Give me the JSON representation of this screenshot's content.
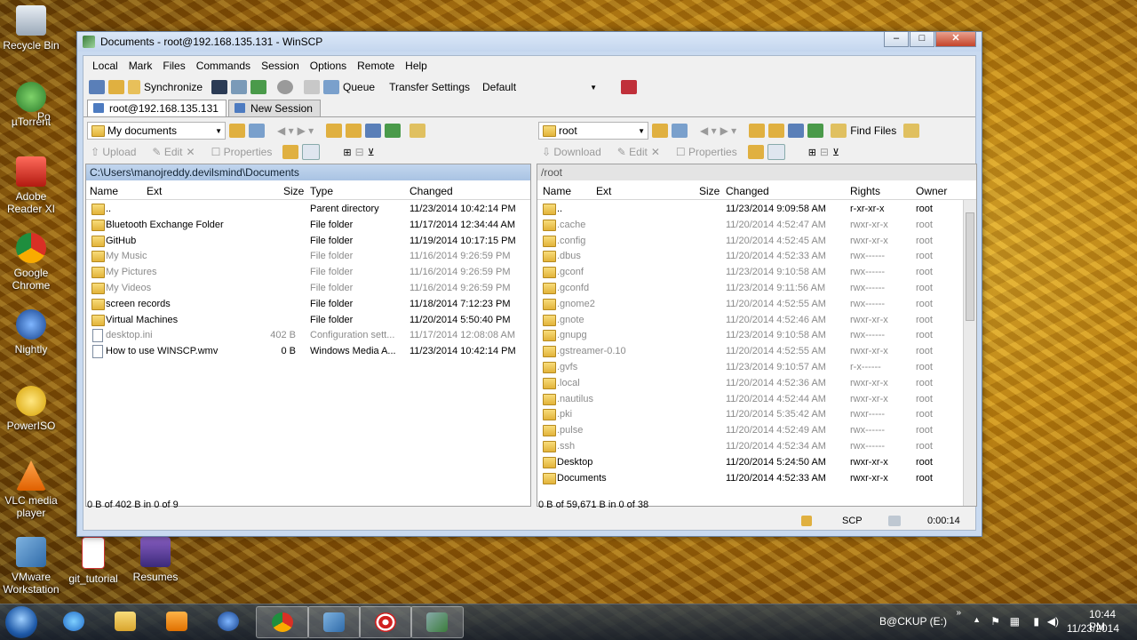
{
  "desktop": {
    "icons": [
      {
        "label": "Recycle Bin"
      },
      {
        "label": "µTorrent"
      },
      {
        "label": "Po"
      },
      {
        "label": "Adobe Reader XI"
      },
      {
        "label": "Google Chrome"
      },
      {
        "label": "Nightly"
      },
      {
        "label": "PowerISO"
      },
      {
        "label": "VLC media player"
      },
      {
        "label": "VMware Workstation"
      },
      {
        "label": "git_tutorial"
      },
      {
        "label": "Resumes"
      }
    ]
  },
  "window": {
    "title": "Documents - root@192.168.135.131 - WinSCP",
    "menu": [
      "Local",
      "Mark",
      "Files",
      "Commands",
      "Session",
      "Options",
      "Remote",
      "Help"
    ],
    "toolbar": {
      "synchronize": "Synchronize",
      "queue": "Queue",
      "transfer_settings": "Transfer Settings",
      "transfer_preset": "Default"
    },
    "tabs": [
      {
        "label": "root@192.168.135.131"
      },
      {
        "label": "New Session"
      }
    ],
    "left": {
      "location": "My documents",
      "actions": {
        "upload": "Upload",
        "edit": "Edit",
        "properties": "Properties"
      },
      "path": "C:\\Users\\manojreddy.devilsmind\\Documents",
      "columns": {
        "name": "Name",
        "ext": "Ext",
        "size": "Size",
        "type": "Type",
        "changed": "Changed"
      },
      "files": [
        {
          "name": "..",
          "size": "",
          "type": "Parent directory",
          "changed": "11/23/2014  10:42:14 PM",
          "icon": "up",
          "dim": false
        },
        {
          "name": "Bluetooth Exchange Folder",
          "size": "",
          "type": "File folder",
          "changed": "11/17/2014  12:34:44 AM",
          "icon": "folder",
          "dim": false
        },
        {
          "name": "GitHub",
          "size": "",
          "type": "File folder",
          "changed": "11/19/2014  10:17:15 PM",
          "icon": "folder",
          "dim": false
        },
        {
          "name": "My Music",
          "size": "",
          "type": "File folder",
          "changed": "11/16/2014  9:26:59 PM",
          "icon": "folder",
          "dim": true
        },
        {
          "name": "My Pictures",
          "size": "",
          "type": "File folder",
          "changed": "11/16/2014  9:26:59 PM",
          "icon": "folder",
          "dim": true
        },
        {
          "name": "My Videos",
          "size": "",
          "type": "File folder",
          "changed": "11/16/2014  9:26:59 PM",
          "icon": "folder",
          "dim": true
        },
        {
          "name": "screen records",
          "size": "",
          "type": "File folder",
          "changed": "11/18/2014  7:12:23 PM",
          "icon": "folder",
          "dim": false
        },
        {
          "name": "Virtual Machines",
          "size": "",
          "type": "File folder",
          "changed": "11/20/2014  5:50:40 PM",
          "icon": "folder",
          "dim": false
        },
        {
          "name": "desktop.ini",
          "size": "402 B",
          "type": "Configuration sett...",
          "changed": "11/17/2014  12:08:08 AM",
          "icon": "file",
          "dim": true
        },
        {
          "name": "How to use WINSCP.wmv",
          "size": "0 B",
          "type": "Windows Media A...",
          "changed": "11/23/2014  10:42:14 PM",
          "icon": "file",
          "dim": false
        }
      ],
      "status": "0 B of 402 B in 0 of 9"
    },
    "right": {
      "location": "root",
      "find_files": "Find Files",
      "actions": {
        "download": "Download",
        "edit": "Edit",
        "properties": "Properties"
      },
      "path": "/root",
      "columns": {
        "name": "Name",
        "ext": "Ext",
        "size": "Size",
        "changed": "Changed",
        "rights": "Rights",
        "owner": "Owner"
      },
      "files": [
        {
          "name": "..",
          "changed": "11/23/2014 9:09:58 AM",
          "rights": "r-xr-xr-x",
          "owner": "root",
          "dim": false
        },
        {
          "name": ".cache",
          "changed": "11/20/2014 4:52:47 AM",
          "rights": "rwxr-xr-x",
          "owner": "root",
          "dim": true
        },
        {
          "name": ".config",
          "changed": "11/20/2014 4:52:45 AM",
          "rights": "rwxr-xr-x",
          "owner": "root",
          "dim": true
        },
        {
          "name": ".dbus",
          "changed": "11/20/2014 4:52:33 AM",
          "rights": "rwx------",
          "owner": "root",
          "dim": true
        },
        {
          "name": ".gconf",
          "changed": "11/23/2014 9:10:58 AM",
          "rights": "rwx------",
          "owner": "root",
          "dim": true
        },
        {
          "name": ".gconfd",
          "changed": "11/23/2014 9:11:56 AM",
          "rights": "rwx------",
          "owner": "root",
          "dim": true
        },
        {
          "name": ".gnome2",
          "changed": "11/20/2014 4:52:55 AM",
          "rights": "rwx------",
          "owner": "root",
          "dim": true
        },
        {
          "name": ".gnote",
          "changed": "11/20/2014 4:52:46 AM",
          "rights": "rwxr-xr-x",
          "owner": "root",
          "dim": true
        },
        {
          "name": ".gnupg",
          "changed": "11/23/2014 9:10:58 AM",
          "rights": "rwx------",
          "owner": "root",
          "dim": true
        },
        {
          "name": ".gstreamer-0.10",
          "changed": "11/20/2014 4:52:55 AM",
          "rights": "rwxr-xr-x",
          "owner": "root",
          "dim": true
        },
        {
          "name": ".gvfs",
          "changed": "11/23/2014 9:10:57 AM",
          "rights": "r-x------",
          "owner": "root",
          "dim": true
        },
        {
          "name": ".local",
          "changed": "11/20/2014 4:52:36 AM",
          "rights": "rwxr-xr-x",
          "owner": "root",
          "dim": true
        },
        {
          "name": ".nautilus",
          "changed": "11/20/2014 4:52:44 AM",
          "rights": "rwxr-xr-x",
          "owner": "root",
          "dim": true
        },
        {
          "name": ".pki",
          "changed": "11/20/2014 5:35:42 AM",
          "rights": "rwxr-----",
          "owner": "root",
          "dim": true
        },
        {
          "name": ".pulse",
          "changed": "11/20/2014 4:52:49 AM",
          "rights": "rwx------",
          "owner": "root",
          "dim": true
        },
        {
          "name": ".ssh",
          "changed": "11/20/2014 4:52:34 AM",
          "rights": "rwx------",
          "owner": "root",
          "dim": true
        },
        {
          "name": "Desktop",
          "changed": "11/20/2014 5:24:50 AM",
          "rights": "rwxr-xr-x",
          "owner": "root",
          "dim": false
        },
        {
          "name": "Documents",
          "changed": "11/20/2014 4:52:33 AM",
          "rights": "rwxr-xr-x",
          "owner": "root",
          "dim": false
        }
      ],
      "status": "0 B of 59,671 B in 0 of 38"
    },
    "status_protocol": "SCP",
    "status_time": "0:00:14"
  },
  "taskbar": {
    "drive": "B@CKUP (E:)",
    "time": "10:44 PM",
    "date": "11/23/2014"
  },
  "colors": {
    "selection": "#c2d6ee",
    "window_frame": "#c9daf0",
    "close": "#c4442a"
  }
}
